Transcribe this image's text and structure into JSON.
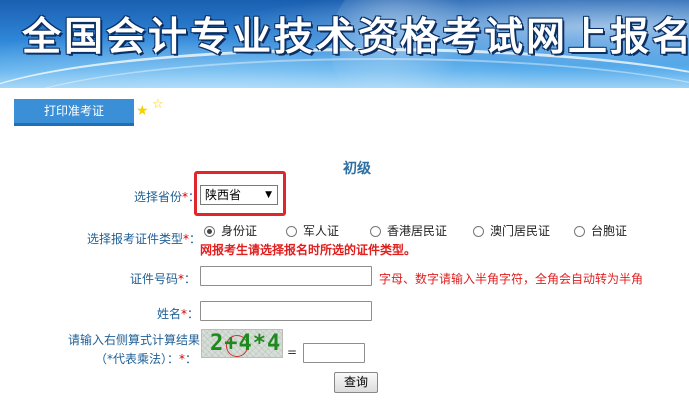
{
  "header": {
    "title": "全国会计专业技术资格考试网上报名系统"
  },
  "nav": {
    "tab_label": "打印准考证"
  },
  "form": {
    "level": "初级",
    "required_mark": "*",
    "province": {
      "label": "选择省份",
      "suffix": "：",
      "value": "陕西省"
    },
    "id_type": {
      "label": "选择报考证件类型",
      "suffix": "：",
      "options": [
        "身份证",
        "军人证",
        "香港居民证",
        "澳门居民证",
        "台胞证"
      ],
      "selected": "身份证",
      "warning": "网报考生请选择报名时所选的证件类型。"
    },
    "id_number": {
      "label": "证件号码",
      "suffix": "：",
      "hint": "字母、数字请输入半角字符，全角会自动转为半角",
      "value": ""
    },
    "name": {
      "label": "姓名",
      "suffix": "：",
      "value": ""
    },
    "captcha": {
      "label_line1": "请输入右侧算式计算结果",
      "label_line2": "（*代表乘法）：",
      "expression": "2+4*4",
      "equals": "=",
      "value": ""
    },
    "submit_label": "查询"
  },
  "colors": {
    "highlight_border": "#e0262b",
    "warning_text": "#e01f1f",
    "label_text": "#1f5f95"
  }
}
